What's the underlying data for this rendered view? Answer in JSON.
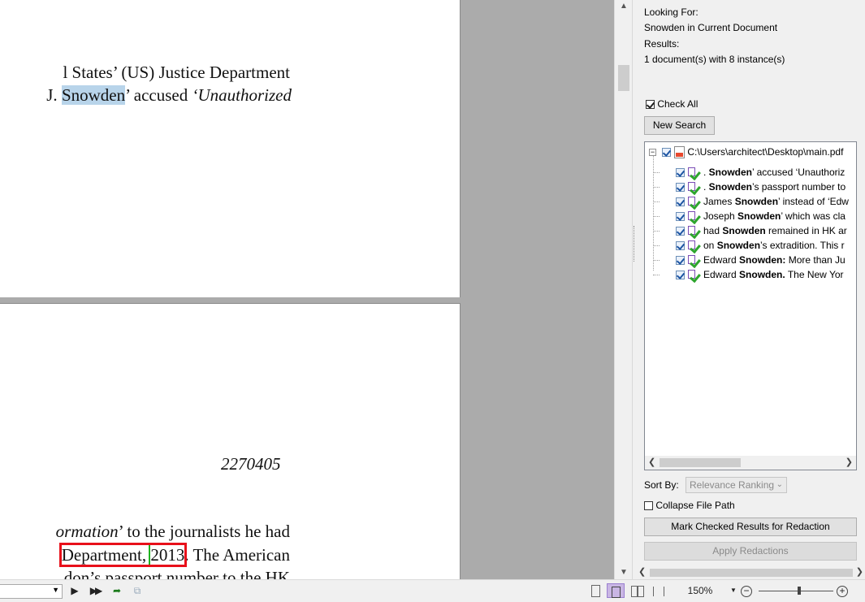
{
  "document": {
    "page1_lines": [
      {
        "a": "l States’ (US) Justice Department"
      },
      {
        "a": "J. ",
        "hl": "Snowden",
        "b": "’ accused ",
        "c": "‘Unauthorized"
      }
    ],
    "page2_number": "2270405",
    "page2_line1": {
      "a": "ormation",
      "b": "’ to the journalists he had"
    },
    "page2_line2": {
      "boxed": " Department, ",
      "green": "2013",
      "after": ". The American"
    },
    "page2_line3": "don’s passport number to the HK"
  },
  "panel": {
    "looking_for_label": "Looking For:",
    "looking_for_value": "Snowden in Current Document",
    "results_label": "Results:",
    "results_value": "1 document(s) with 8 instance(s)",
    "check_all_label": "Check All",
    "new_search_label": "New Search",
    "file_path": "C:\\Users\\architect\\Desktop\\main.pdf",
    "results": [
      {
        "pre": ". ",
        "term": "Snowden",
        "post": "’ accused ‘Unauthoriz"
      },
      {
        "pre": ". ",
        "term": "Snowden",
        "post": "’s passport number to"
      },
      {
        "pre": "James ",
        "term": "Snowden",
        "post": "’ instead of ‘Edw"
      },
      {
        "pre": "Joseph ",
        "term": "Snowden",
        "post": "’ which was cla"
      },
      {
        "pre": "had ",
        "term": "Snowden",
        "post": " remained in HK ar"
      },
      {
        "pre": "on ",
        "term": "Snowden",
        "post": "’s extradition. This r"
      },
      {
        "pre": "Edward ",
        "term": "Snowden:",
        "post": " More than Ju"
      },
      {
        "pre": "Edward ",
        "term": "Snowden.",
        "post": " The New Yor"
      }
    ],
    "sort_by_label": "Sort By:",
    "sort_by_value": "Relevance Ranking",
    "collapse_label": "Collapse File Path",
    "mark_button": "Mark Checked Results for Redaction",
    "apply_button": "Apply Redactions"
  },
  "statusbar": {
    "zoom": "150%"
  }
}
